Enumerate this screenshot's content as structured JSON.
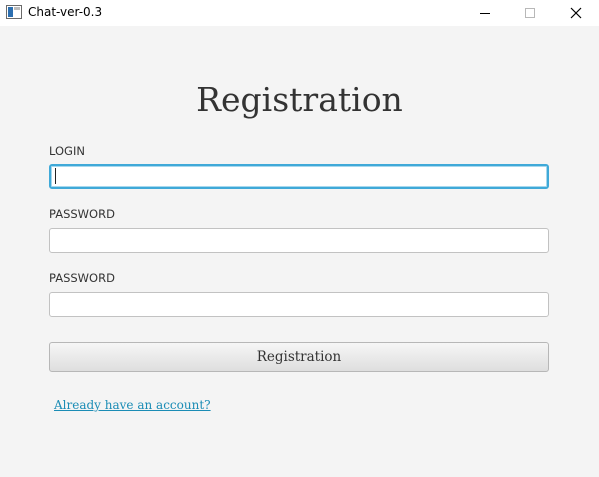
{
  "window": {
    "title": "Chat-ver-0.3",
    "controls": {
      "minimize": "minimize-icon",
      "maximize": "maximize-icon",
      "close": "close-icon"
    }
  },
  "form": {
    "heading": "Registration",
    "fields": [
      {
        "label": "LOGIN",
        "value": "",
        "focused": true
      },
      {
        "label": "PASSWORD",
        "value": ""
      },
      {
        "label": "PASSWORD",
        "value": ""
      }
    ],
    "submit_label": "Registration",
    "login_link": "Already have an account?"
  },
  "colors": {
    "background": "#f4f4f4",
    "focus_ring": "#3fa9d8",
    "link": "#1a8cb5",
    "text": "#333333"
  }
}
